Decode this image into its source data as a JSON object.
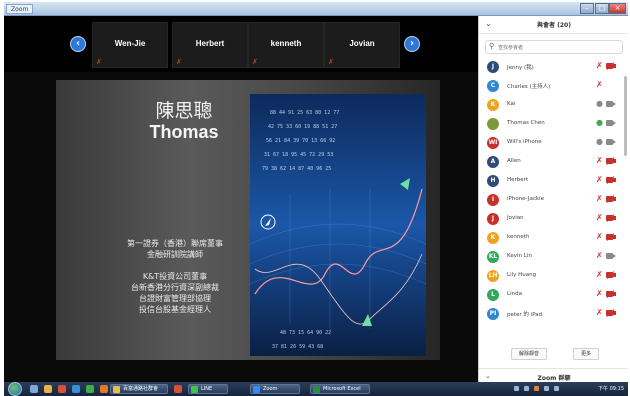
{
  "window": {
    "app_tab": "Zoom"
  },
  "strip": {
    "tiles": [
      {
        "name": "Wen-Jie"
      },
      {
        "name": "Herbert"
      },
      {
        "name": "kenneth"
      },
      {
        "name": "Jovian"
      }
    ]
  },
  "slide": {
    "chinese_name": "陳思聰",
    "english_name": "Thomas",
    "lines_group1": [
      "第一證券（香港）聯席董事",
      "金融研訓院講師"
    ],
    "lines_group2": [
      "K&T投資公司董事",
      "台新香港分行資深副總裁",
      "台證財富管理部協理",
      "投信台股基金經理人"
    ]
  },
  "panel": {
    "title": "與會者 (20)",
    "search_placeholder": "查找參會者",
    "participants": [
      {
        "name": "Jenny (我)",
        "initial": "J",
        "color": "#2e4a7a",
        "mic": "muted",
        "cam": "off"
      },
      {
        "name": "Charles (主持人)",
        "initial": "C",
        "color": "#2d87d3",
        "mic": "muted",
        "cam": "none"
      },
      {
        "name": "Kai",
        "initial": "K",
        "color": "#f0a21f",
        "mic": "on",
        "cam": "on"
      },
      {
        "name": "Thomas Chen",
        "initial": "",
        "color": "#7a9a3a",
        "mic": "on-green",
        "cam": "on"
      },
      {
        "name": "Will's iPhone",
        "initial": "WI",
        "color": "#c9302c",
        "mic": "on",
        "cam": "on"
      },
      {
        "name": "Allen",
        "initial": "A",
        "color": "#2e4a7a",
        "mic": "muted",
        "cam": "off"
      },
      {
        "name": "Herbert",
        "initial": "H",
        "color": "#2e4a7a",
        "mic": "muted",
        "cam": "off"
      },
      {
        "name": "iPhone-Jackie",
        "initial": "I",
        "color": "#c9302c",
        "mic": "muted",
        "cam": "off"
      },
      {
        "name": "Jovian",
        "initial": "J",
        "color": "#c9302c",
        "mic": "muted",
        "cam": "off"
      },
      {
        "name": "kenneth",
        "initial": "K",
        "color": "#f0a21f",
        "mic": "muted",
        "cam": "off"
      },
      {
        "name": "Kevin Lin",
        "initial": "KL",
        "color": "#2eaa5a",
        "mic": "muted",
        "cam": "on"
      },
      {
        "name": "Lily Huang",
        "initial": "LH",
        "color": "#f0a21f",
        "mic": "muted",
        "cam": "off"
      },
      {
        "name": "Linda",
        "initial": "L",
        "color": "#2eaa5a",
        "mic": "muted",
        "cam": "off"
      },
      {
        "name": "peter 的 iPad",
        "initial": "PI",
        "color": "#2d87d3",
        "mic": "muted",
        "cam": "off"
      }
    ],
    "mute_all_label": "解除靜音",
    "more_label": "更多",
    "chat_title": "Zoom 群聊"
  },
  "taskbar": {
    "tasks": [
      {
        "label": "百富通路社群會"
      },
      {
        "label": "LINE"
      },
      {
        "label": "Zoom"
      },
      {
        "label": "Microsoft Excel"
      }
    ],
    "clock": "下午 09:15"
  },
  "colors": {
    "accent": "#2d78d6",
    "muted_red": "#c9302c"
  }
}
